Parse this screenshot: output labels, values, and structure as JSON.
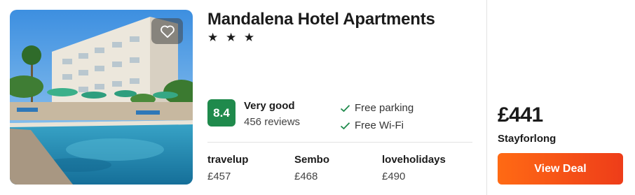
{
  "hotel": {
    "name": "Mandalena Hotel Apartments",
    "stars": "★ ★ ★",
    "star_rating": 3
  },
  "rating": {
    "score": "8.4",
    "label": "Very good",
    "reviews": "456 reviews"
  },
  "amenities": [
    {
      "label": "Free parking",
      "icon": "check-icon"
    },
    {
      "label": "Free Wi-Fi",
      "icon": "check-icon"
    }
  ],
  "providers": [
    {
      "name": "travelup",
      "price": "£457"
    },
    {
      "name": "Sembo",
      "price": "£468"
    },
    {
      "name": "loveholidays",
      "price": "£490"
    }
  ],
  "deal": {
    "price": "£441",
    "seller": "Stayforlong",
    "button_label": "View Deal"
  },
  "icons": {
    "favorite": "heart-icon"
  },
  "colors": {
    "score_badge": "#1f8a4c",
    "check": "#1f8a4c",
    "button_start": "#ff6a14",
    "button_end": "#ee3d19"
  }
}
